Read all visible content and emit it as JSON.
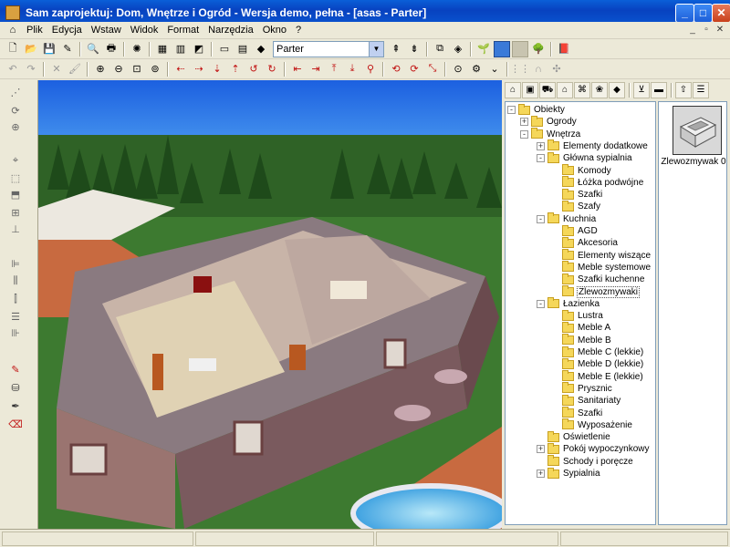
{
  "window": {
    "title": "Sam zaprojektuj: Dom, Wnętrze i Ogród  -  Wersja demo, pełna - [asas - Parter]"
  },
  "menu": [
    "Plik",
    "Edycja",
    "Wstaw",
    "Widok",
    "Format",
    "Narzędzia",
    "Okno",
    "?"
  ],
  "toolbar": {
    "floor_select": "Parter"
  },
  "tree": {
    "items": [
      {
        "label": "Obiekty",
        "level": 0,
        "expander": "-"
      },
      {
        "label": "Ogrody",
        "level": 1,
        "expander": "+"
      },
      {
        "label": "Wnętrza",
        "level": 1,
        "expander": "-"
      },
      {
        "label": "Elementy dodatkowe",
        "level": 2,
        "expander": "+"
      },
      {
        "label": "Główna sypialnia",
        "level": 2,
        "expander": "-"
      },
      {
        "label": "Komody",
        "level": 3,
        "expander": ""
      },
      {
        "label": "Łóżka podwójne",
        "level": 3,
        "expander": ""
      },
      {
        "label": "Szafki",
        "level": 3,
        "expander": ""
      },
      {
        "label": "Szafy",
        "level": 3,
        "expander": ""
      },
      {
        "label": "Kuchnia",
        "level": 2,
        "expander": "-"
      },
      {
        "label": "AGD",
        "level": 3,
        "expander": ""
      },
      {
        "label": "Akcesoria",
        "level": 3,
        "expander": ""
      },
      {
        "label": "Elementy wiszące",
        "level": 3,
        "expander": ""
      },
      {
        "label": "Meble systemowe",
        "level": 3,
        "expander": ""
      },
      {
        "label": "Szafki kuchenne",
        "level": 3,
        "expander": ""
      },
      {
        "label": "Zlewozmywaki",
        "level": 3,
        "expander": "",
        "selected": true
      },
      {
        "label": "Łazienka",
        "level": 2,
        "expander": "-"
      },
      {
        "label": "Lustra",
        "level": 3,
        "expander": ""
      },
      {
        "label": "Meble A",
        "level": 3,
        "expander": ""
      },
      {
        "label": "Meble B",
        "level": 3,
        "expander": ""
      },
      {
        "label": "Meble C (lekkie)",
        "level": 3,
        "expander": ""
      },
      {
        "label": "Meble D (lekkie)",
        "level": 3,
        "expander": ""
      },
      {
        "label": "Meble E (lekkie)",
        "level": 3,
        "expander": ""
      },
      {
        "label": "Prysznic",
        "level": 3,
        "expander": ""
      },
      {
        "label": "Sanitariaty",
        "level": 3,
        "expander": ""
      },
      {
        "label": "Szafki",
        "level": 3,
        "expander": ""
      },
      {
        "label": "Wyposażenie",
        "level": 3,
        "expander": ""
      },
      {
        "label": "Oświetlenie",
        "level": 2,
        "expander": ""
      },
      {
        "label": "Pokój wypoczynkowy",
        "level": 2,
        "expander": "+"
      },
      {
        "label": "Schody i poręcze",
        "level": 2,
        "expander": ""
      },
      {
        "label": "Sypialnia",
        "level": 2,
        "expander": "+"
      }
    ]
  },
  "preview": {
    "label": "Zlewozmywak 0"
  },
  "colors": {
    "titlebar": "#0842c0",
    "sky": "#1f6ee8",
    "grass": "#3d7a30",
    "wall": "#8a6e72",
    "floor": "#c8b4a8"
  }
}
